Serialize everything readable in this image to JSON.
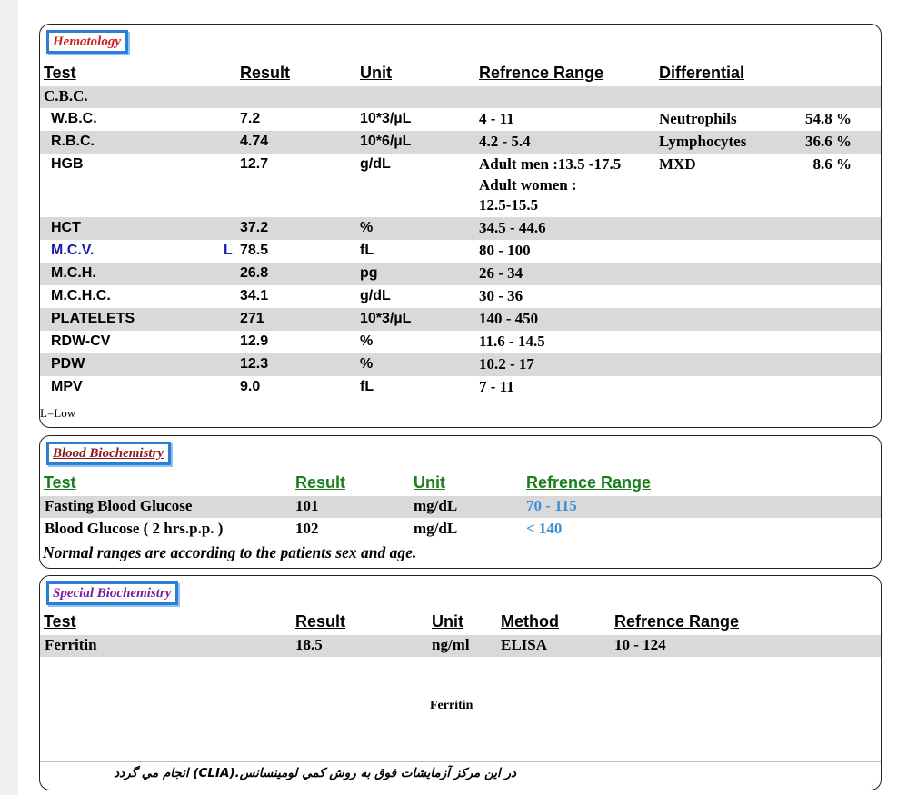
{
  "hematology": {
    "title": "Hematology",
    "headers": {
      "test": "Test",
      "result": "Result",
      "unit": "Unit",
      "range": "Refrence Range",
      "diff": "Differential"
    },
    "group_label": "C.B.C.",
    "rows": [
      {
        "test": "W.B.C.",
        "flag": "",
        "result": "7.2",
        "unit": "10*3/µL",
        "range": [
          "4 - 11"
        ],
        "band": false
      },
      {
        "test": "R.B.C.",
        "flag": "",
        "result": "4.74",
        "unit": "10*6/µL",
        "range": [
          "4.2 - 5.4"
        ],
        "band": true
      },
      {
        "test": "HGB",
        "flag": "",
        "result": "12.7",
        "unit": "g/dL",
        "range": [
          "Adult men :13.5 -17.5",
          "Adult women :",
          "12.5-15.5"
        ],
        "band": false
      },
      {
        "test": "HCT",
        "flag": "",
        "result": "37.2",
        "unit": "%",
        "range": [
          "34.5 - 44.6"
        ],
        "band": true
      },
      {
        "test": "M.C.V.",
        "flag": "L",
        "result": "78.5",
        "unit": "fL",
        "range": [
          "80 - 100"
        ],
        "band": false
      },
      {
        "test": "M.C.H.",
        "flag": "",
        "result": "26.8",
        "unit": "pg",
        "range": [
          "26 - 34"
        ],
        "band": true
      },
      {
        "test": "M.C.H.C.",
        "flag": "",
        "result": "34.1",
        "unit": "g/dL",
        "range": [
          "30 - 36"
        ],
        "band": false
      },
      {
        "test": "PLATELETS",
        "flag": "",
        "result": "271",
        "unit": "10*3/µL",
        "range": [
          "140 - 450"
        ],
        "band": true
      },
      {
        "test": "RDW-CV",
        "flag": "",
        "result": "12.9",
        "unit": "%",
        "range": [
          "11.6 - 14.5"
        ],
        "band": false
      },
      {
        "test": "PDW",
        "flag": "",
        "result": "12.3",
        "unit": "%",
        "range": [
          "10.2 - 17"
        ],
        "band": true
      },
      {
        "test": "MPV",
        "flag": "",
        "result": "9.0",
        "unit": "fL",
        "range": [
          "7 - 11"
        ],
        "band": false
      }
    ],
    "differential": [
      {
        "name": "Neutrophils",
        "value": "54.8 %"
      },
      {
        "name": "Lymphocytes",
        "value": "36.6 %"
      },
      {
        "name": "MXD",
        "value": "8.6 %"
      }
    ],
    "legend": "L=Low",
    "colors": {
      "title": "#d01c1c",
      "low_flag": "#1a1ab0"
    }
  },
  "blood_biochemistry": {
    "title": "Blood Biochemistry",
    "headers": {
      "test": "Test",
      "result": "Result",
      "unit": "Unit",
      "range": "Refrence Range"
    },
    "rows": [
      {
        "test": "Fasting Blood Glucose",
        "result": "101",
        "unit": "mg/dL",
        "range": "70 - 115"
      },
      {
        "test": "Blood Glucose ( 2 hrs.p.p. )",
        "result": "102",
        "unit": "mg/dL",
        "range": "< 140"
      }
    ],
    "note": "Normal ranges are according to the patients sex and age.",
    "colors": {
      "title": "#8b1a1a",
      "header": "#1b7d1b",
      "range": "#3a8fd6"
    }
  },
  "special_biochemistry": {
    "title": "Special Biochemistry",
    "headers": {
      "test": "Test",
      "result": "Result",
      "unit": "Unit",
      "method": "Method",
      "range": "Refrence Range"
    },
    "row": {
      "test": "Ferritin",
      "result": "18.5",
      "unit": "ng/ml",
      "method": "ELISA",
      "range": "10 - 124"
    },
    "chart_caption": "Ferritin",
    "footer": "در اين مركز آزمايشات فوق به روش كمي لومينسانس.(CLIA) انجام مي گردد",
    "colors": {
      "title": "#7a1a9a"
    }
  }
}
